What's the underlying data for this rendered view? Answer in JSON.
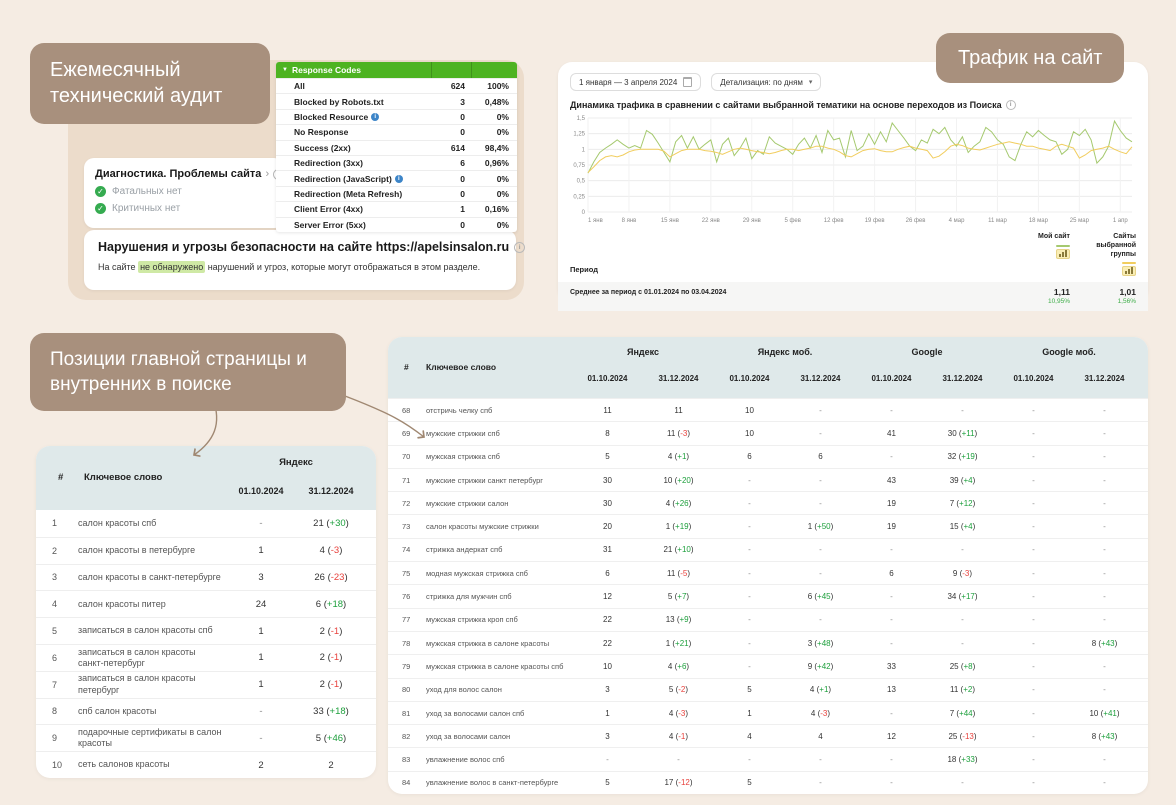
{
  "labels": {
    "audit": "Ежемесячный технический аудит",
    "traffic": "Трафик на сайт",
    "positions": "Позиции главной страницы и внутренних в поиске"
  },
  "icons": {
    "triangle": "▼",
    "chevron": "›",
    "info": "i",
    "caret": "▾",
    "check": "✓"
  },
  "response_codes": {
    "title": "Response Codes",
    "rows": [
      {
        "label": "All",
        "value": "624",
        "pct": "100%",
        "info": false
      },
      {
        "label": "Blocked by Robots.txt",
        "value": "3",
        "pct": "0,48%",
        "info": false
      },
      {
        "label": "Blocked Resource",
        "value": "0",
        "pct": "0%",
        "info": true
      },
      {
        "label": "No Response",
        "value": "0",
        "pct": "0%",
        "info": false
      },
      {
        "label": "Success (2xx)",
        "value": "614",
        "pct": "98,4%",
        "info": false
      },
      {
        "label": "Redirection (3xx)",
        "value": "6",
        "pct": "0,96%",
        "info": false
      },
      {
        "label": "Redirection (JavaScript)",
        "value": "0",
        "pct": "0%",
        "info": true
      },
      {
        "label": "Redirection (Meta Refresh)",
        "value": "0",
        "pct": "0%",
        "info": false
      },
      {
        "label": "Client Error (4xx)",
        "value": "1",
        "pct": "0,16%",
        "info": false
      },
      {
        "label": "Server Error (5xx)",
        "value": "0",
        "pct": "0%",
        "info": false
      }
    ]
  },
  "diagnostics": {
    "title": "Диагностика. Проблемы сайта",
    "items": [
      "Фатальных нет",
      "Критичных нет"
    ]
  },
  "security": {
    "title": "Нарушения и угрозы безопасности на сайте https://apelsinsalon.ru",
    "text_before": "На сайте ",
    "highlight": "не обнаружено",
    "text_after": " нарушений и угроз, которые могут отображаться в этом разделе."
  },
  "traffic": {
    "date_range": "1 января — 3 апреля 2024",
    "detail_label": "Детализация: по дням",
    "chart_title": "Динамика трафика в сравнении с сайтами выбранной тематики на основе переходов из Поиска",
    "period_label": "Период",
    "my_site_label": "Мой сайт",
    "group_label": "Сайты выбранной группы",
    "avg_label": "Среднее за период с 01.01.2024 по 03.04.2024",
    "my_site_avg": "1,11",
    "my_site_change": "10,95%",
    "group_avg": "1,01",
    "group_change": "1,56%"
  },
  "chart_data": {
    "type": "line",
    "title": "Динамика трафика в сравнении с сайтами выбранной тематики на основе переходов из Поиска",
    "ylim": [
      0,
      1.5
    ],
    "y_ticks": [
      "1,5",
      "1,25",
      "1",
      "0,75",
      "0,5",
      "0,25",
      "0"
    ],
    "x_ticks": [
      "1 янв",
      "8 янв",
      "15 янв",
      "22 янв",
      "29 янв",
      "5 фев",
      "12 фев",
      "19 фев",
      "26 фев",
      "4 мар",
      "11 мар",
      "18 мар",
      "25 мар",
      "1 апр"
    ],
    "grid": true,
    "legend_position": "bottom",
    "series": [
      {
        "name": "Мой сайт",
        "color": "#a5c96f",
        "values": [
          0.62,
          0.8,
          0.95,
          1.02,
          1.08,
          1.15,
          1.08,
          1.02,
          1.06,
          1.02,
          1.3,
          1.24,
          1.1,
          0.95,
          0.8,
          1.12,
          1.22,
          1.02,
          1.2,
          1.0,
          1.08,
          1.15,
          0.8,
          1.08,
          1.18,
          0.9,
          1.02,
          1.18,
          0.85,
          0.98,
          0.92,
          1.2,
          1.1,
          1.05,
          1.0,
          0.92,
          1.08,
          1.18,
          1.02,
          1.22,
          0.95,
          1.3,
          1.15,
          1.18,
          0.88,
          1.3,
          0.98,
          1.05,
          1.25,
          1.08,
          1.28,
          1.12,
          1.42,
          1.3,
          1.18,
          1.05,
          0.98,
          1.15,
          1.1,
          1.32,
          1.25,
          1.35,
          1.15,
          1.05,
          1.2,
          0.95,
          1.05,
          1.12,
          1.35,
          1.28,
          1.15,
          1.08,
          0.88,
          0.82,
          1.08,
          1.28,
          1.2,
          1.3,
          1.22,
          1.15,
          1.12,
          0.92,
          1.0,
          1.28,
          1.22,
          1.32,
          1.15,
          0.78,
          0.88,
          1.05,
          1.45,
          1.3,
          1.18,
          1.12
        ]
      },
      {
        "name": "Сайты выбранной группы",
        "color": "#f1cd5e",
        "values": [
          0.63,
          0.72,
          0.82,
          0.88,
          0.9,
          0.88,
          0.91,
          0.96,
          0.99,
          1.0,
          1.0,
          1.0,
          1.0,
          0.97,
          0.88,
          0.93,
          0.98,
          1.0,
          1.0,
          1.0,
          0.98,
          0.97,
          0.95,
          0.92,
          0.96,
          1.0,
          1.02,
          1.0,
          0.98,
          0.96,
          0.95,
          0.93,
          0.95,
          0.98,
          1.0,
          1.0,
          0.98,
          1.0,
          1.02,
          1.05,
          1.05,
          1.02,
          1.0,
          0.96,
          0.9,
          0.88,
          0.93,
          0.98,
          1.0,
          1.01,
          0.98,
          0.96,
          0.96,
          1.0,
          1.03,
          1.05,
          1.02,
          1.0,
          0.98,
          0.86,
          0.89,
          0.96,
          1.05,
          1.08,
          1.06,
          1.02,
          1.0,
          0.99,
          1.02,
          1.05,
          1.08,
          1.1,
          1.12,
          1.1,
          1.08,
          1.05,
          1.05,
          1.02,
          1.0,
          0.98,
          1.05,
          1.08,
          1.05,
          1.02,
          0.86,
          0.91,
          0.98,
          1.0,
          1.02,
          1.05,
          1.0,
          0.96,
          0.93,
          1.04
        ]
      }
    ]
  },
  "small_table": {
    "num_header": "#",
    "keyword_header": "Ключевое слово",
    "group_header": "Яндекс",
    "dates": [
      "01.10.2024",
      "31.12.2024"
    ],
    "rows": [
      {
        "n": "1",
        "k": "салон красоты спб",
        "c": [
          "-",
          "21 (+30)"
        ]
      },
      {
        "n": "2",
        "k": "салон красоты в петербурге",
        "c": [
          "1",
          "4 (-3)"
        ]
      },
      {
        "n": "3",
        "k": "салон красоты в санкт-петербурге",
        "c": [
          "3",
          "26 (-23)"
        ]
      },
      {
        "n": "4",
        "k": "салон красоты питер",
        "c": [
          "24",
          "6 (+18)"
        ]
      },
      {
        "n": "5",
        "k": "записаться в салон красоты спб",
        "c": [
          "1",
          "2 (-1)"
        ]
      },
      {
        "n": "6",
        "k": "записаться в салон красоты санкт-петербург",
        "c": [
          "1",
          "2 (-1)"
        ]
      },
      {
        "n": "7",
        "k": "записаться в салон красоты петербург",
        "c": [
          "1",
          "2 (-1)"
        ]
      },
      {
        "n": "8",
        "k": "спб салон красоты",
        "c": [
          "-",
          "33 (+18)"
        ]
      },
      {
        "n": "9",
        "k": "подарочные сертификаты в салон красоты",
        "c": [
          "-",
          "5 (+46)"
        ]
      },
      {
        "n": "10",
        "k": "сеть салонов красоты",
        "c": [
          "2",
          "2"
        ]
      }
    ]
  },
  "big_table": {
    "num_header": "#",
    "keyword_header": "Ключевое слово",
    "groups": [
      "Яндекс",
      "Яндекс моб.",
      "Google",
      "Google моб."
    ],
    "dates": [
      "01.10.2024",
      "31.12.2024"
    ],
    "rows": [
      {
        "n": "68",
        "k": "отстричь челку спб",
        "c": [
          "11",
          "11",
          "10",
          "-",
          "-",
          "-",
          "-",
          "-"
        ]
      },
      {
        "n": "69",
        "k": "мужские стрижки спб",
        "c": [
          "8",
          "11 (-3)",
          "10",
          "-",
          "41",
          "30 (+11)",
          "-",
          "-"
        ]
      },
      {
        "n": "70",
        "k": "мужская стрижка спб",
        "c": [
          "5",
          "4 (+1)",
          "6",
          "6",
          "-",
          "32 (+19)",
          "-",
          "-"
        ]
      },
      {
        "n": "71",
        "k": "мужские стрижки санкт петербург",
        "c": [
          "30",
          "10 (+20)",
          "-",
          "-",
          "43",
          "39 (+4)",
          "-",
          "-"
        ]
      },
      {
        "n": "72",
        "k": "мужские стрижки салон",
        "c": [
          "30",
          "4 (+26)",
          "-",
          "-",
          "19",
          "7 (+12)",
          "-",
          "-"
        ]
      },
      {
        "n": "73",
        "k": "салон красоты мужские стрижки",
        "c": [
          "20",
          "1 (+19)",
          "-",
          "1 (+50)",
          "19",
          "15 (+4)",
          "-",
          "-"
        ]
      },
      {
        "n": "74",
        "k": "стрижка андеркат спб",
        "c": [
          "31",
          "21 (+10)",
          "-",
          "-",
          "-",
          "-",
          "-",
          "-"
        ]
      },
      {
        "n": "75",
        "k": "модная мужская стрижка спб",
        "c": [
          "6",
          "11 (-5)",
          "-",
          "-",
          "6",
          "9 (-3)",
          "-",
          "-"
        ]
      },
      {
        "n": "76",
        "k": "стрижка для мужчин спб",
        "c": [
          "12",
          "5 (+7)",
          "-",
          "6 (+45)",
          "-",
          "34 (+17)",
          "-",
          "-"
        ]
      },
      {
        "n": "77",
        "k": "мужская стрижка кроп спб",
        "c": [
          "22",
          "13 (+9)",
          "-",
          "-",
          "-",
          "-",
          "-",
          "-"
        ]
      },
      {
        "n": "78",
        "k": "мужская стрижка в салоне красоты",
        "c": [
          "22",
          "1 (+21)",
          "-",
          "3 (+48)",
          "-",
          "-",
          "-",
          "8 (+43)"
        ]
      },
      {
        "n": "79",
        "k": "мужская стрижка в салоне красоты спб",
        "c": [
          "10",
          "4 (+6)",
          "-",
          "9 (+42)",
          "33",
          "25 (+8)",
          "-",
          "-"
        ]
      },
      {
        "n": "80",
        "k": "уход для волос салон",
        "c": [
          "3",
          "5 (-2)",
          "5",
          "4 (+1)",
          "13",
          "11 (+2)",
          "-",
          "-"
        ]
      },
      {
        "n": "81",
        "k": "уход за волосами салон спб",
        "c": [
          "1",
          "4 (-3)",
          "1",
          "4 (-3)",
          "-",
          "7 (+44)",
          "-",
          "10 (+41)"
        ]
      },
      {
        "n": "82",
        "k": "уход за волосами салон",
        "c": [
          "3",
          "4 (-1)",
          "4",
          "4",
          "12",
          "25 (-13)",
          "-",
          "8 (+43)"
        ]
      },
      {
        "n": "83",
        "k": "увлажнение волос спб",
        "c": [
          "-",
          "-",
          "-",
          "-",
          "-",
          "18 (+33)",
          "-",
          "-"
        ]
      },
      {
        "n": "84",
        "k": "увлажнение волос в санкт-петербурге",
        "c": [
          "5",
          "17 (-12)",
          "5",
          "-",
          "-",
          "-",
          "-",
          "-"
        ]
      }
    ]
  }
}
